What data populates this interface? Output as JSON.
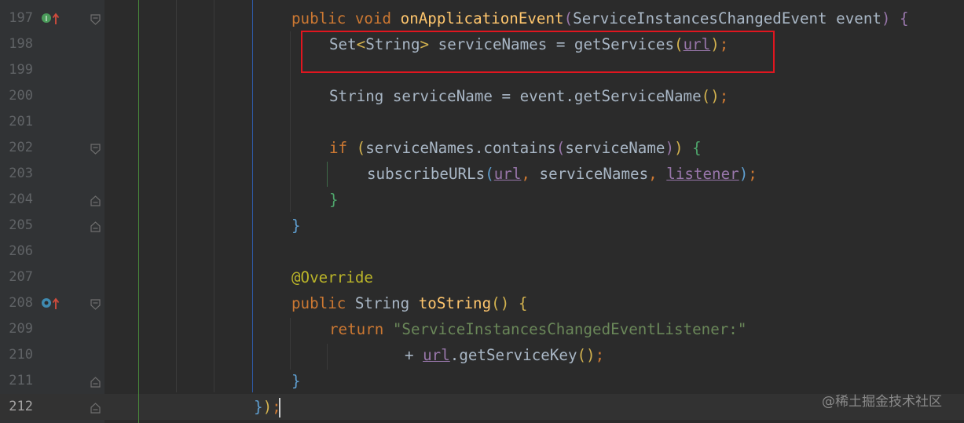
{
  "editor": {
    "lines": [
      {
        "num": "197",
        "tokens": [
          {
            "t": "public",
            "c": "kw"
          },
          {
            "t": " "
          },
          {
            "t": "void",
            "c": "kw"
          },
          {
            "t": " "
          },
          {
            "t": "onApplicationEvent",
            "c": "fn"
          },
          {
            "t": "(",
            "c": "b2"
          },
          {
            "t": "ServiceInstancesChangedEvent event"
          },
          {
            "t": ")",
            "c": "b2"
          },
          {
            "t": " "
          },
          {
            "t": "{",
            "c": "b2"
          }
        ]
      },
      {
        "num": "198",
        "tokens": [
          {
            "t": "Set"
          },
          {
            "t": "<",
            "c": "b1"
          },
          {
            "t": "String"
          },
          {
            "t": ">",
            "c": "b1"
          },
          {
            "t": " serviceNames = getServices"
          },
          {
            "t": "(",
            "c": "b1"
          },
          {
            "t": "url",
            "c": "fld"
          },
          {
            "t": ")",
            "c": "b1"
          },
          {
            "t": ";",
            "c": "kw"
          }
        ]
      },
      {
        "num": "199",
        "tokens": []
      },
      {
        "num": "200",
        "tokens": [
          {
            "t": "String serviceName = event.getServiceName"
          },
          {
            "t": "()",
            "c": "b1"
          },
          {
            "t": ";",
            "c": "kw"
          }
        ]
      },
      {
        "num": "201",
        "tokens": []
      },
      {
        "num": "202",
        "tokens": [
          {
            "t": "if",
            "c": "kw"
          },
          {
            "t": " "
          },
          {
            "t": "(",
            "c": "b1"
          },
          {
            "t": "serviceNames.contains"
          },
          {
            "t": "(",
            "c": "b2"
          },
          {
            "t": "serviceName"
          },
          {
            "t": ")",
            "c": "b2"
          },
          {
            "t": ")",
            "c": "b1"
          },
          {
            "t": " "
          },
          {
            "t": "{",
            "c": "b4"
          }
        ]
      },
      {
        "num": "203",
        "tokens": [
          {
            "t": "subscribeURLs"
          },
          {
            "t": "(",
            "c": "b3"
          },
          {
            "t": "url",
            "c": "fld"
          },
          {
            "t": ",",
            "c": "kw"
          },
          {
            "t": " serviceNames"
          },
          {
            "t": ",",
            "c": "kw"
          },
          {
            "t": " "
          },
          {
            "t": "listener",
            "c": "fld"
          },
          {
            "t": ")",
            "c": "b3"
          },
          {
            "t": ";",
            "c": "kw"
          }
        ]
      },
      {
        "num": "204",
        "tokens": [
          {
            "t": "}",
            "c": "b4"
          }
        ]
      },
      {
        "num": "205",
        "tokens": [
          {
            "t": "}",
            "c": "b3"
          }
        ]
      },
      {
        "num": "206",
        "tokens": []
      },
      {
        "num": "207",
        "tokens": [
          {
            "t": "@Override",
            "c": "ann"
          }
        ]
      },
      {
        "num": "208",
        "tokens": [
          {
            "t": "public",
            "c": "kw"
          },
          {
            "t": " String "
          },
          {
            "t": "toString",
            "c": "fn"
          },
          {
            "t": "()",
            "c": "b1"
          },
          {
            "t": " "
          },
          {
            "t": "{",
            "c": "b1"
          }
        ]
      },
      {
        "num": "209",
        "tokens": [
          {
            "t": "return",
            "c": "kw"
          },
          {
            "t": " "
          },
          {
            "t": "\"ServiceInstancesChangedEventListener:\"",
            "c": "str"
          }
        ]
      },
      {
        "num": "210",
        "tokens": [
          {
            "t": "+ "
          },
          {
            "t": "url",
            "c": "fld"
          },
          {
            "t": ".getServiceKey"
          },
          {
            "t": "()",
            "c": "b1"
          },
          {
            "t": ";",
            "c": "kw"
          }
        ]
      },
      {
        "num": "211",
        "tokens": [
          {
            "t": "}",
            "c": "b3"
          }
        ]
      },
      {
        "num": "212",
        "tokens": [
          {
            "t": "}",
            "c": "b3"
          },
          {
            "t": ")",
            "c": "b1"
          },
          {
            "t": ";",
            "c": "kw"
          }
        ]
      }
    ]
  },
  "watermark": "@稀土掘金技术社区"
}
